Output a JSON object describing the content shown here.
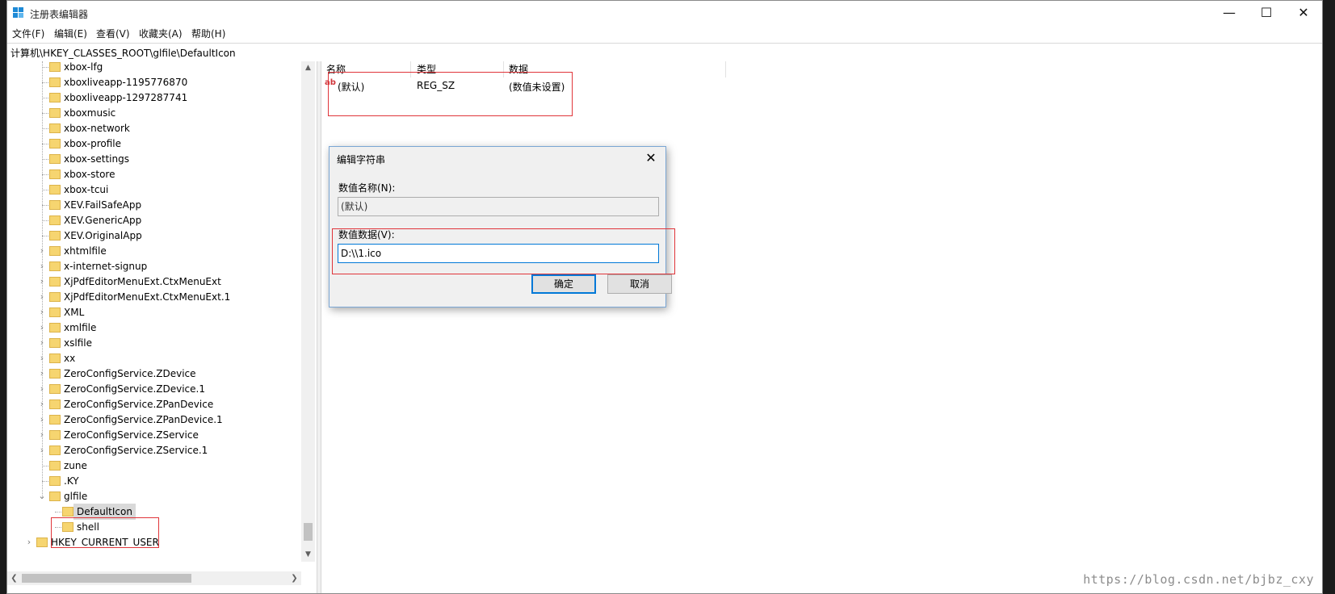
{
  "window": {
    "title": "注册表编辑器",
    "minimize": "—",
    "maximize": "☐",
    "close": "✕"
  },
  "menu": [
    "文件(F)",
    "编辑(E)",
    "查看(V)",
    "收藏夹(A)",
    "帮助(H)"
  ],
  "address": "计算机\\HKEY_CLASSES_ROOT\\glfile\\DefaultIcon",
  "tree": {
    "items": [
      {
        "label": "xbox-lfg",
        "expandable": false
      },
      {
        "label": "xboxliveapp-1195776870",
        "expandable": false
      },
      {
        "label": "xboxliveapp-1297287741",
        "expandable": false
      },
      {
        "label": "xboxmusic",
        "expandable": false
      },
      {
        "label": "xbox-network",
        "expandable": false
      },
      {
        "label": "xbox-profile",
        "expandable": false
      },
      {
        "label": "xbox-settings",
        "expandable": false
      },
      {
        "label": "xbox-store",
        "expandable": false
      },
      {
        "label": "xbox-tcui",
        "expandable": false
      },
      {
        "label": "XEV.FailSafeApp",
        "expandable": false
      },
      {
        "label": "XEV.GenericApp",
        "expandable": false
      },
      {
        "label": "XEV.OriginalApp",
        "expandable": false
      },
      {
        "label": "xhtmlfile",
        "expandable": true
      },
      {
        "label": "x-internet-signup",
        "expandable": true
      },
      {
        "label": "XjPdfEditorMenuExt.CtxMenuExt",
        "expandable": true
      },
      {
        "label": "XjPdfEditorMenuExt.CtxMenuExt.1",
        "expandable": true
      },
      {
        "label": "XML",
        "expandable": true
      },
      {
        "label": "xmlfile",
        "expandable": true
      },
      {
        "label": "xslfile",
        "expandable": true
      },
      {
        "label": "xx",
        "expandable": true
      },
      {
        "label": "ZeroConfigService.ZDevice",
        "expandable": true
      },
      {
        "label": "ZeroConfigService.ZDevice.1",
        "expandable": true
      },
      {
        "label": "ZeroConfigService.ZPanDevice",
        "expandable": true
      },
      {
        "label": "ZeroConfigService.ZPanDevice.1",
        "expandable": true
      },
      {
        "label": "ZeroConfigService.ZService",
        "expandable": true
      },
      {
        "label": "ZeroConfigService.ZService.1",
        "expandable": true
      },
      {
        "label": "zune",
        "expandable": false
      },
      {
        "label": ".KY",
        "expandable": false
      },
      {
        "label": "glfile",
        "expandable": true,
        "expanded": true
      },
      {
        "label": "DefaultIcon",
        "expandable": false,
        "selected": true
      },
      {
        "label": "shell",
        "expandable": false
      },
      {
        "label": "HKEY_CURRENT_USER",
        "expandable": true
      }
    ]
  },
  "list": {
    "headers": {
      "name": "名称",
      "type": "类型",
      "data": "数据"
    },
    "rows": [
      {
        "icon": "ab",
        "name": "(默认)",
        "type": "REG_SZ",
        "data": "(数值未设置)"
      }
    ]
  },
  "dialog": {
    "title": "编辑字符串",
    "close": "✕",
    "name_label": "数值名称(N):",
    "name_value": "(默认)",
    "data_label": "数值数据(V):",
    "data_value": "D:\\\\1.ico",
    "ok": "确定",
    "cancel": "取消"
  },
  "watermark": "https://blog.csdn.net/bjbz_cxy",
  "colors": {
    "highlight_red": "#e0353a",
    "focus_blue": "#0078d7",
    "folder_yellow": "#f6d570"
  }
}
